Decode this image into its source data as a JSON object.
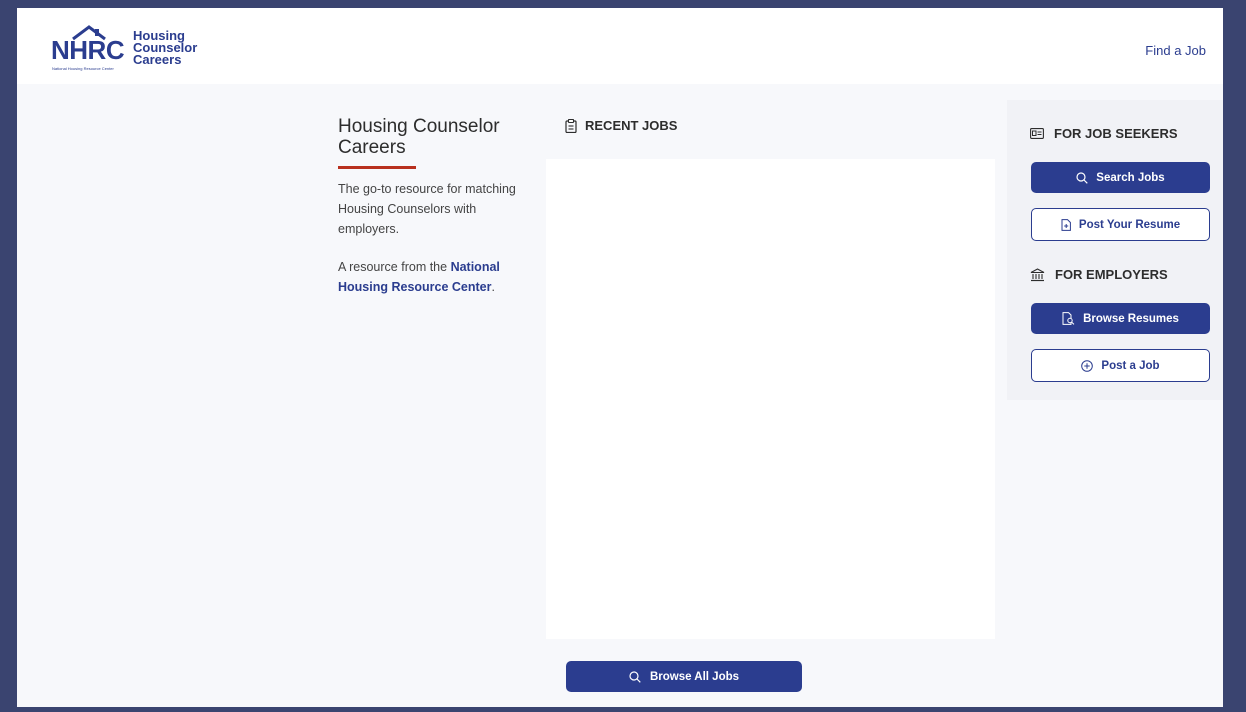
{
  "header": {
    "logo_letters": "NHRC",
    "logo_subtitle": "National Housing Resource Center",
    "logo_lines": [
      "Housing",
      "Counselor",
      "Careers"
    ],
    "nav_find_job": "Find a Job"
  },
  "intro": {
    "title": "Housing Counselor Careers",
    "description": "The go-to resource for matching Housing Counselors with employers.",
    "resource_prefix": "A resource from the ",
    "resource_link": "National Housing Resource Center",
    "resource_suffix": "."
  },
  "recent_jobs": {
    "heading": "RECENT JOBS",
    "browse_all_label": "Browse All Jobs"
  },
  "job_seekers": {
    "heading": "FOR JOB SEEKERS",
    "search_label": "Search Jobs",
    "post_resume_label": "Post Your Resume"
  },
  "employers": {
    "heading": "FOR EMPLOYERS",
    "browse_resumes_label": "Browse Resumes",
    "post_job_label": "Post a Job"
  },
  "colors": {
    "brand_blue": "#2b3d8f",
    "accent_red": "#b8301e",
    "frame": "#3a4470"
  }
}
